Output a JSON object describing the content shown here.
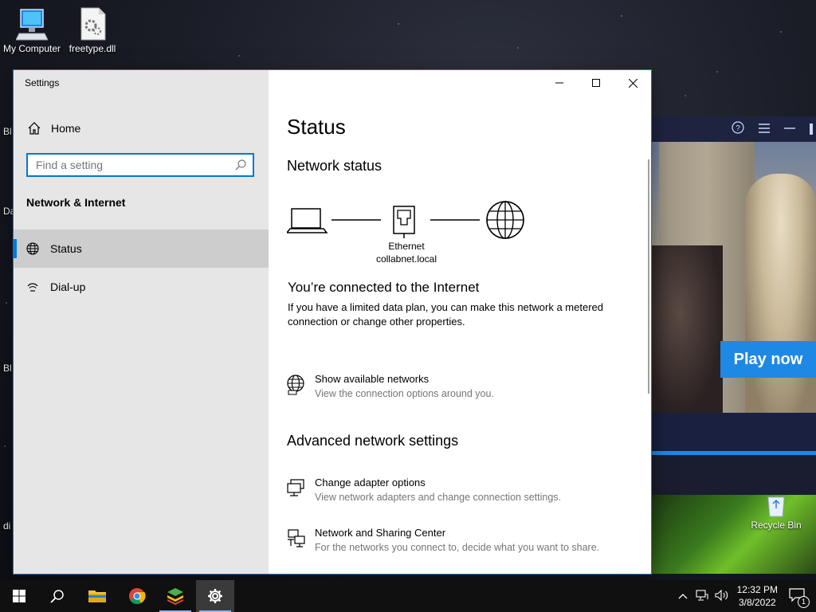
{
  "desktop": {
    "icons": [
      {
        "label": "My Computer"
      },
      {
        "label": "freetype.dll"
      },
      {
        "label": "Recycle Bin"
      }
    ],
    "edge_labels": [
      "Bl",
      "Da",
      "Bl",
      "di"
    ]
  },
  "game_ad": {
    "play_label": "Play now",
    "accent": "#1e88e5"
  },
  "settings": {
    "window_title": "Settings",
    "sidebar": {
      "home_label": "Home",
      "search_placeholder": "Find a setting",
      "section_title": "Network & Internet",
      "items": [
        {
          "label": "Status",
          "icon": "globe-icon",
          "active": true
        },
        {
          "label": "Dial-up",
          "icon": "dialup-icon",
          "active": false
        }
      ]
    },
    "main": {
      "title": "Status",
      "network_status_heading": "Network status",
      "adapter_name": "Ethernet",
      "network_name": "collabnet.local",
      "connected_title": "You’re connected to the Internet",
      "connected_desc": "If you have a limited data plan, you can make this network a metered connection or change other properties.",
      "show_networks": {
        "title": "Show available networks",
        "subtitle": "View the connection options around you."
      },
      "advanced_heading": "Advanced network settings",
      "options": [
        {
          "title": "Change adapter options",
          "subtitle": "View network adapters and change connection settings.",
          "icon": "adapter-icon"
        },
        {
          "title": "Network and Sharing Center",
          "subtitle": "For the networks you connect to, decide what you want to share.",
          "icon": "sharing-center-icon"
        }
      ]
    }
  },
  "taskbar": {
    "time": "12:32 PM",
    "date": "3/8/2022",
    "notification_count": "1"
  },
  "colors": {
    "accent": "#0078d7",
    "sidebar_bg": "#e6e6e6",
    "taskbar_bg": "#101010"
  }
}
